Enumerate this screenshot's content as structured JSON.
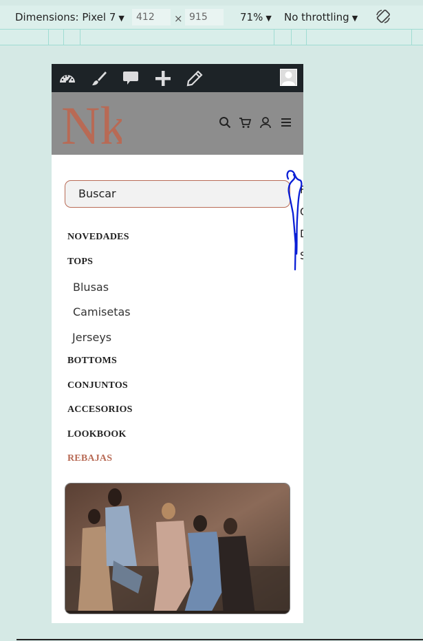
{
  "devtools": {
    "device_label": "Dimensions: Pixel 7",
    "width": "412",
    "times": "×",
    "height": "915",
    "zoom": "71%",
    "throttling": "No throttling",
    "rotate_icon": "rotate-icon"
  },
  "adminbar": {
    "icons": [
      "dashboard-icon",
      "brush-icon",
      "comment-icon",
      "plus-icon",
      "pencil-icon"
    ],
    "avatar_icon": "user-avatar-icon"
  },
  "header": {
    "logo_text": "Nk",
    "icons": [
      "search-icon",
      "cart-icon",
      "account-icon",
      "menu-icon"
    ]
  },
  "search": {
    "placeholder": "Buscar"
  },
  "menu": {
    "items": [
      {
        "label": "NOVEDADES"
      },
      {
        "label": "TOPS"
      },
      {
        "label": "Blusas"
      },
      {
        "label": "Camisetas"
      },
      {
        "label": "Jerseys"
      },
      {
        "label": "BOTTOMS"
      },
      {
        "label": "CONJUNTOS"
      },
      {
        "label": "ACCESORIOS"
      },
      {
        "label": "LOOKBOOK"
      },
      {
        "label": "REBAJAS"
      }
    ]
  },
  "side_letters": [
    "F",
    "C",
    "D",
    "S"
  ],
  "colors": {
    "accent": "#b86a55",
    "admin_bar": "#1d2327",
    "header_bg": "#8d8d8d",
    "annotation": "#0a1fd6"
  }
}
